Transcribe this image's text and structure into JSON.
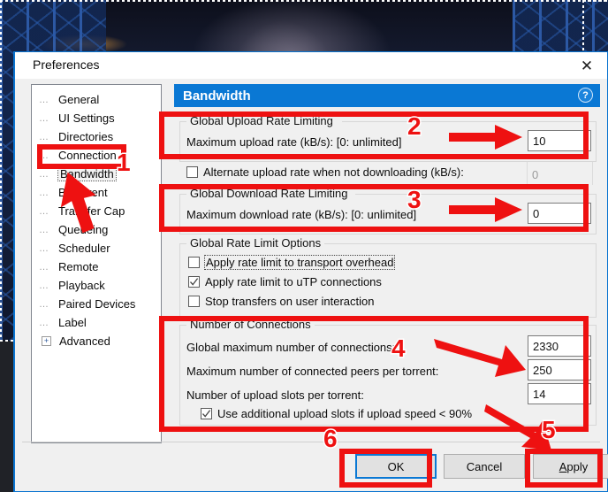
{
  "desktop": {
    "wallpaper_alt": "dark night sky wallpaper with blue lattice towers and orange clouds"
  },
  "dialog": {
    "title": "Preferences",
    "close_icon": "close-icon"
  },
  "sidebar": {
    "items": [
      {
        "label": "General",
        "selected": false,
        "expandable": false
      },
      {
        "label": "UI Settings",
        "selected": false,
        "expandable": false
      },
      {
        "label": "Directories",
        "selected": false,
        "expandable": false
      },
      {
        "label": "Connection",
        "selected": false,
        "expandable": false
      },
      {
        "label": "Bandwidth",
        "selected": true,
        "expandable": false
      },
      {
        "label": "BitTorrent",
        "selected": false,
        "expandable": false
      },
      {
        "label": "Transfer Cap",
        "selected": false,
        "expandable": false
      },
      {
        "label": "Queueing",
        "selected": false,
        "expandable": false
      },
      {
        "label": "Scheduler",
        "selected": false,
        "expandable": false
      },
      {
        "label": "Remote",
        "selected": false,
        "expandable": false
      },
      {
        "label": "Playback",
        "selected": false,
        "expandable": false
      },
      {
        "label": "Paired Devices",
        "selected": false,
        "expandable": false
      },
      {
        "label": "Label",
        "selected": false,
        "expandable": false
      },
      {
        "label": "Advanced",
        "selected": false,
        "expandable": true
      }
    ]
  },
  "content": {
    "header_title": "Bandwidth",
    "help_icon": "help-icon",
    "upload_group": {
      "legend": "Global Upload Rate Limiting",
      "max_rate_label": "Maximum upload rate (kB/s): [0: unlimited]",
      "max_rate_value": "10"
    },
    "alternate_row": {
      "checkbox_label": "Alternate upload rate when not downloading (kB/s):",
      "checked": false,
      "value": "0",
      "disabled": true
    },
    "download_group": {
      "legend": "Global Download Rate Limiting",
      "max_rate_label": "Maximum download rate (kB/s): [0: unlimited]",
      "max_rate_value": "0"
    },
    "rate_limit_options": {
      "legend": "Global Rate Limit Options",
      "options": [
        {
          "label": "Apply rate limit to transport overhead",
          "checked": false,
          "focused": true
        },
        {
          "label": "Apply rate limit to uTP connections",
          "checked": true,
          "focused": false
        },
        {
          "label": "Stop transfers on user interaction",
          "checked": false,
          "focused": false
        }
      ]
    },
    "connections_group": {
      "legend": "Number of Connections",
      "rows": [
        {
          "label": "Global maximum number of connections:",
          "value": "2330"
        },
        {
          "label": "Maximum number of connected peers per torrent:",
          "value": "250"
        },
        {
          "label": "Number of upload slots per torrent:",
          "value": "14"
        }
      ],
      "extra_checkbox": {
        "label": "Use additional upload slots if upload speed < 90%",
        "checked": true
      }
    }
  },
  "buttons": {
    "ok": "OK",
    "cancel": "Cancel",
    "apply_prefix": "A",
    "apply_rest": "pply"
  },
  "annotations": {
    "accent_color": "#ee1111",
    "markers": [
      {
        "number": "1",
        "target": "sidebar-item-bandwidth"
      },
      {
        "number": "2",
        "target": "global-upload-rate-limiting-group"
      },
      {
        "number": "3",
        "target": "global-download-rate-limiting-group"
      },
      {
        "number": "4",
        "target": "number-of-connections-group"
      },
      {
        "number": "5",
        "target": "apply-button"
      },
      {
        "number": "6",
        "target": "ok-button"
      }
    ]
  }
}
